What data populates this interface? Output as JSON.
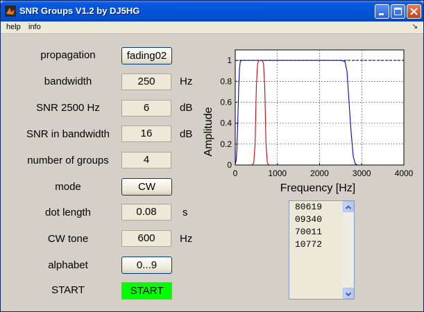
{
  "window": {
    "title": "SNR Groups V1.2 by DJ5HG"
  },
  "menu": {
    "items": [
      "help",
      "info"
    ],
    "arrow": "↘"
  },
  "form": {
    "propagation": {
      "label": "propagation",
      "value": "fading02"
    },
    "bandwidth": {
      "label": "bandwidth",
      "value": "250",
      "unit": "Hz"
    },
    "snr2500": {
      "label": "SNR 2500 Hz",
      "value": "6",
      "unit": "dB"
    },
    "snrbw": {
      "label": "SNR in bandwidth",
      "value": "16",
      "unit": "dB"
    },
    "groups": {
      "label": "number of groups",
      "value": "4"
    },
    "mode": {
      "label": "mode",
      "value": "CW"
    },
    "dot": {
      "label": "dot length",
      "value": "0.08",
      "unit": "s"
    },
    "tone": {
      "label": "CW tone",
      "value": "600",
      "unit": "Hz"
    },
    "alphabet": {
      "label": "alphabet",
      "value": "0...9"
    },
    "start": {
      "label": "START",
      "button": "START"
    }
  },
  "listbox": {
    "items": [
      "80619",
      "09340",
      "70011",
      "10772"
    ]
  },
  "chart_data": {
    "type": "line",
    "xlabel": "Frequency [Hz]",
    "ylabel": "Amplitude",
    "xlim": [
      0,
      4000
    ],
    "ylim": [
      0,
      1.1
    ],
    "xticks": [
      0,
      1000,
      2000,
      3000,
      4000
    ],
    "yticks": [
      0,
      0.2,
      0.4,
      0.6,
      0.8,
      1
    ],
    "grid": true,
    "series": [
      {
        "color": "#0000cc",
        "x": [
          0,
          20,
          40,
          60,
          80,
          100,
          120,
          150,
          200,
          300,
          400,
          1000,
          1500,
          2000,
          2500,
          2600,
          2650,
          2700,
          2750,
          2800,
          2850,
          2900,
          4000
        ],
        "y": [
          0.01,
          0.04,
          0.15,
          0.4,
          0.72,
          0.92,
          0.99,
          1.0,
          1.0,
          1.0,
          1.0,
          1.0,
          1.0,
          1.0,
          1.0,
          0.99,
          0.9,
          0.6,
          0.3,
          0.08,
          0.01,
          0.0,
          0.0
        ]
      },
      {
        "color": "#cc0000",
        "x": [
          0,
          400,
          440,
          470,
          500,
          530,
          560,
          600,
          640,
          670,
          700,
          730,
          760,
          800,
          4000
        ],
        "y": [
          0,
          0,
          0.02,
          0.2,
          0.75,
          0.97,
          1.0,
          1.0,
          1.0,
          0.97,
          0.75,
          0.2,
          0.02,
          0,
          0
        ]
      },
      {
        "color": "#000066",
        "style": "dashed",
        "x": [
          0,
          4000
        ],
        "y": [
          1.0,
          1.0
        ]
      }
    ]
  }
}
